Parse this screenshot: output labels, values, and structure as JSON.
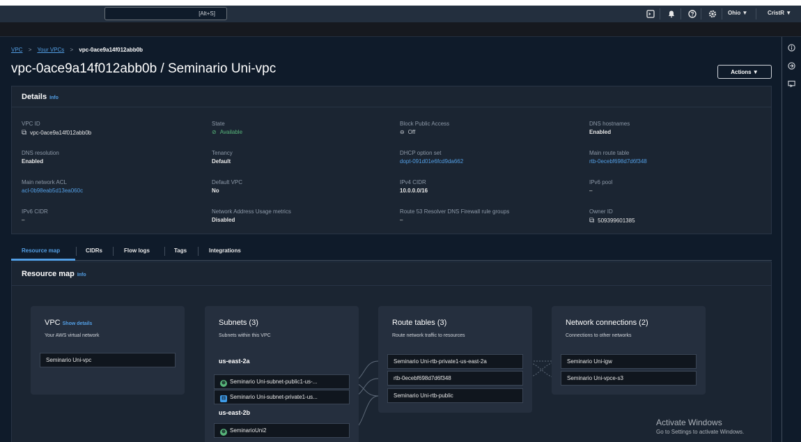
{
  "topbar": {
    "search_shortcut": "[Alt+S]",
    "region": "Ohio ▼",
    "user": "CristR ▼",
    "icons": [
      "cloudshell-icon",
      "bell-icon",
      "help-icon",
      "settings-icon"
    ]
  },
  "breadcrumb": {
    "items": [
      "VPC",
      "Your VPCs",
      "vpc-0ace9a14f012abb0b"
    ],
    "separator": ">"
  },
  "page": {
    "title": "vpc-0ace9a14f012abb0b / Seminario Uni-vpc",
    "actions_label": "Actions ▼"
  },
  "details": {
    "title": "Details",
    "info": "Info",
    "fields": [
      {
        "label": "VPC ID",
        "value": "vpc-0ace9a14f012abb0b"
      },
      {
        "label": "State",
        "value": "Available"
      },
      {
        "label": "Block Public Access",
        "value": "Off"
      },
      {
        "label": "DNS hostnames",
        "value": "Enabled"
      },
      {
        "label": "DNS resolution",
        "value": "Enabled"
      },
      {
        "label": "Tenancy",
        "value": "Default"
      },
      {
        "label": "DHCP option set",
        "value": "dopt-091d01e6fcd9da662"
      },
      {
        "label": "Main route table",
        "value": "rtb-0ecebf698d7d6f348"
      },
      {
        "label": "Main network ACL",
        "value": "acl-0b98eab5d13ea060c"
      },
      {
        "label": "Default VPC",
        "value": "No"
      },
      {
        "label": "IPv4 CIDR",
        "value": "10.0.0.0/16"
      },
      {
        "label": "IPv6 pool",
        "value": "–"
      },
      {
        "label": "IPv6 CIDR",
        "value": "–"
      },
      {
        "label": "Network Address Usage metrics",
        "value": "Disabled"
      },
      {
        "label": "Route 53 Resolver DNS Firewall rule groups",
        "value": "–"
      },
      {
        "label": "Owner ID",
        "value": "509399601385"
      }
    ]
  },
  "tabs": [
    "Resource map",
    "CIDRs",
    "Flow logs",
    "Tags",
    "Integrations"
  ],
  "resource_map": {
    "title": "Resource map",
    "info": "Info",
    "vpc": {
      "title": "VPC",
      "show_details": "Show details",
      "subtitle": "Your AWS virtual network",
      "items": [
        "Seminario Uni-vpc"
      ]
    },
    "subnets": {
      "title": "Subnets (3)",
      "subtitle": "Subnets within this VPC",
      "az1": "us-east-2a",
      "az2": "us-east-2b",
      "items": [
        "Seminario Uni-subnet-public1-us-...",
        "Seminario Uni-subnet-private1-us...",
        "SeminarioUni2"
      ]
    },
    "route_tables": {
      "title": "Route tables (3)",
      "subtitle": "Route network traffic to resources",
      "items": [
        "Seminario Uni-rtb-private1-us-east-2a",
        "rtb-0ecebf698d7d6f348",
        "Seminario Uni-rtb-public"
      ]
    },
    "network_connections": {
      "title": "Network connections (2)",
      "subtitle": "Connections to other networks",
      "items": [
        "Seminario Uni-igw",
        "Seminario Uni-vpce-s3"
      ]
    }
  },
  "watermark": {
    "line1": "Activate Windows",
    "line2": "Go to Settings to activate Windows."
  },
  "colors": {
    "accent": "#539fe5",
    "available": "#57b57a",
    "public_subnet": "#57b57a",
    "private_subnet": "#3f9ce8",
    "background": "#0f1b2a",
    "panel": "#1b2532"
  }
}
